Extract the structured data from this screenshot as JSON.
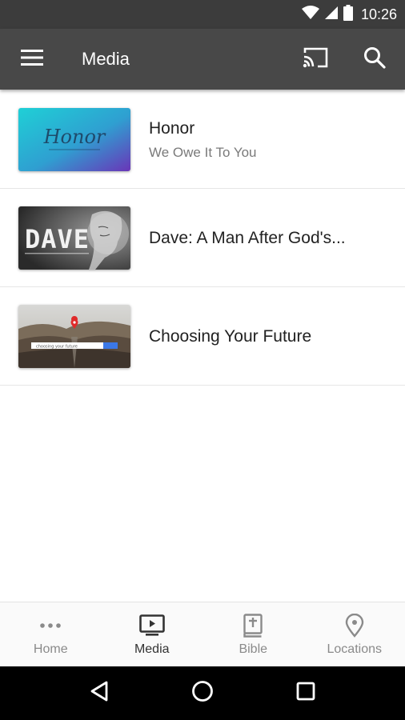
{
  "status_bar": {
    "time": "10:26",
    "icons": [
      "wifi-icon",
      "signal-icon",
      "battery-icon"
    ]
  },
  "app_bar": {
    "title": "Media",
    "icons": [
      "menu-icon",
      "cast-icon",
      "search-icon"
    ]
  },
  "media_items": [
    {
      "title": "Honor",
      "subtitle": "We Owe It To You",
      "thumbnail_text": "Honor"
    },
    {
      "title": "Dave: A Man After God's...",
      "subtitle": "",
      "thumbnail_text": "DAVE"
    },
    {
      "title": "Choosing Your Future",
      "subtitle": "",
      "thumbnail_text": "choosing your future"
    }
  ],
  "bottom_nav": [
    {
      "label": "Home",
      "icon": "more-dots-icon",
      "active": false
    },
    {
      "label": "Media",
      "icon": "tv-play-icon",
      "active": true
    },
    {
      "label": "Bible",
      "icon": "bible-icon",
      "active": false
    },
    {
      "label": "Locations",
      "icon": "location-pin-icon",
      "active": false
    }
  ],
  "system_nav": [
    "back-icon",
    "home-circle-icon",
    "recents-icon"
  ],
  "colors": {
    "status_bar": "#3c3c3c",
    "app_bar": "#484848",
    "text_primary": "#222222",
    "text_secondary": "#7a7a7a",
    "nav_inactive": "#8a8a8a"
  }
}
